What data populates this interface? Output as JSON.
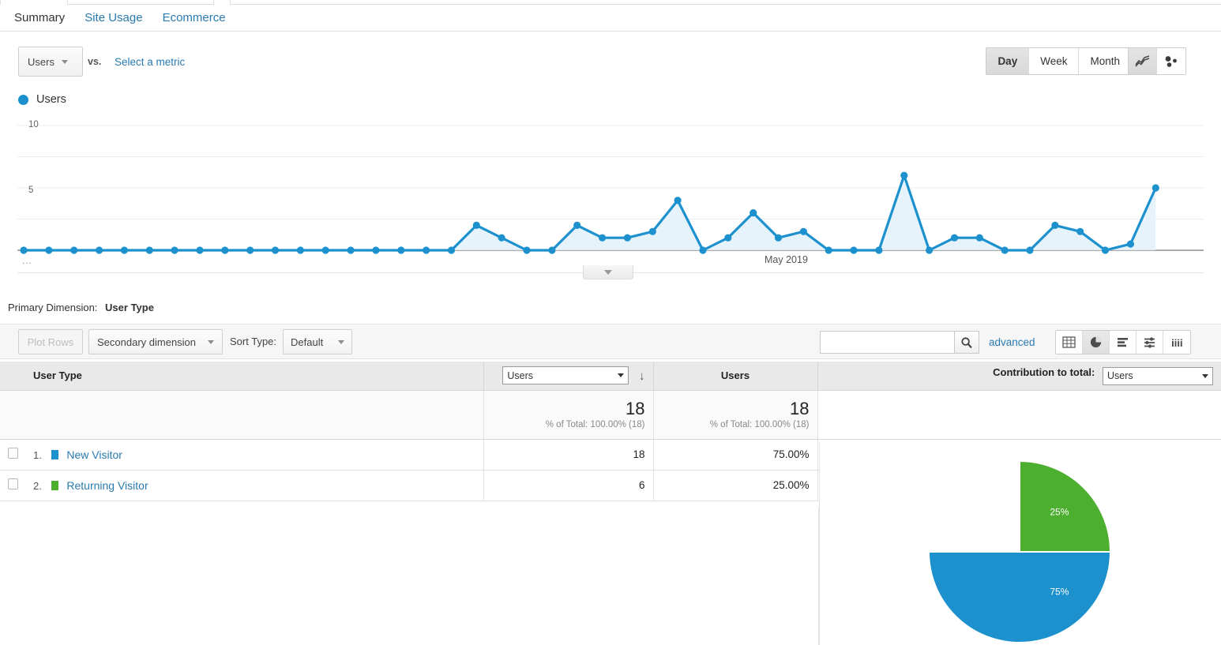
{
  "tabs": [
    {
      "label": "Summary",
      "active": true
    },
    {
      "label": "Site Usage",
      "active": false
    },
    {
      "label": "Ecommerce",
      "active": false
    }
  ],
  "metric_selector": {
    "primary_metric": "Users",
    "vs_label": "vs.",
    "select_metric_link": "Select a metric"
  },
  "granularity": {
    "options": [
      "Day",
      "Week",
      "Month"
    ],
    "selected": "Day"
  },
  "chart_type_toggle": {
    "line_icon": "line-chart-icon",
    "motion_icon": "motion-chart-icon",
    "selected": "line-chart-icon"
  },
  "chart_legend": {
    "series_name": "Users",
    "color": "#1c91ce"
  },
  "chart_data": {
    "type": "line",
    "title": "Users",
    "xlabel": "",
    "ylabel": "Users",
    "ylim": [
      0,
      10
    ],
    "yticks": [
      0,
      2.5,
      5,
      7.5,
      10
    ],
    "ytick_labels": [
      "",
      "",
      "5",
      "",
      "10"
    ],
    "grid": true,
    "legend_position": "top-left",
    "x_axis_annotation": "May 2019",
    "x_axis_truncation_marker": "...",
    "series_color": "#1c91ce",
    "fill_color": "#e3f1fa",
    "values": [
      0,
      0,
      0,
      0,
      0,
      0,
      0,
      0,
      0,
      0,
      0,
      0,
      0,
      0,
      0,
      0,
      0,
      0,
      2,
      1,
      0,
      0,
      2,
      1,
      1,
      1.5,
      4,
      0,
      1,
      3,
      1,
      1.5,
      0,
      0,
      0,
      6,
      0,
      1,
      1,
      0,
      0,
      2,
      1.5,
      0,
      0.5,
      5
    ],
    "point_count": 46
  },
  "collapse_control": {
    "icon": "chevron-down-icon"
  },
  "primary_dimension": {
    "label": "Primary Dimension:",
    "value": "User Type"
  },
  "table_toolbar": {
    "plot_rows_label": "Plot Rows",
    "plot_rows_disabled": true,
    "secondary_dimension_label": "Secondary dimension",
    "sort_type_label": "Sort Type:",
    "sort_type_value": "Default",
    "search_value": "",
    "search_placeholder": "",
    "search_icon": "search-icon",
    "advanced_link": "advanced",
    "view_icons": [
      {
        "name": "table-view-icon",
        "selected": false
      },
      {
        "name": "pie-view-icon",
        "selected": true
      },
      {
        "name": "bar-view-icon",
        "selected": false
      },
      {
        "name": "performance-view-icon",
        "selected": false
      },
      {
        "name": "pivot-view-icon",
        "selected": false
      }
    ]
  },
  "table": {
    "headers": {
      "dimension": "User Type",
      "metric_select_value": "Users",
      "sort_arrow": "↓",
      "metric2": "Users",
      "contribution_label": "Contribution to total:",
      "contribution_value": "Users"
    },
    "totals": {
      "metric1_value": "18",
      "metric1_sub": "% of Total: 100.00% (18)",
      "metric2_value": "18",
      "metric2_sub": "% of Total: 100.00% (18)"
    },
    "rows": [
      {
        "index": "1.",
        "label": "New Visitor",
        "color": "#1c91ce",
        "users": "18",
        "pct": "75.00%"
      },
      {
        "index": "2.",
        "label": "Returning Visitor",
        "color": "#4caf2f",
        "users": "6",
        "pct": "25.00%"
      }
    ]
  },
  "pie_chart": {
    "type": "pie",
    "title": "",
    "slices": [
      {
        "label": "New Visitor",
        "value": 75,
        "display": "75%",
        "color": "#1c91ce"
      },
      {
        "label": "Returning Visitor",
        "value": 25,
        "display": "25%",
        "color": "#4caf2f"
      }
    ]
  }
}
